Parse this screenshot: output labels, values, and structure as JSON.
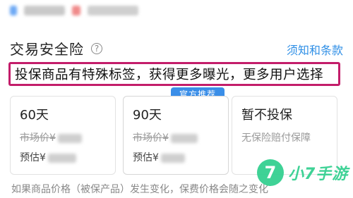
{
  "header": {
    "title": "交易安全险",
    "help_icon": "question-circle-icon",
    "terms_link": "须知和条款"
  },
  "banner": {
    "text": "投保商品有特殊标签，获得更多曝光，更多用户选择"
  },
  "recommend_tag": "官方推荐",
  "options": [
    {
      "name": "60天",
      "strike_text": "市场价¥",
      "estimate_text": "预估¥"
    },
    {
      "name": "90天",
      "strike_text": "市场价¥",
      "estimate_text": "预估¥"
    },
    {
      "name": "暂不投保",
      "description": "无保险赔付保障"
    }
  ],
  "footer": {
    "note": "如果商品价格（被保产品）发生变化，保费价格会随之变化"
  },
  "watermark": {
    "badge": "7",
    "text": "小7手游"
  },
  "colors": {
    "accent": "#2f8fe6",
    "highlight_border": "#c31d6a",
    "tag_bg": "#3a8ee8",
    "watermark": "#2fcf8e"
  }
}
